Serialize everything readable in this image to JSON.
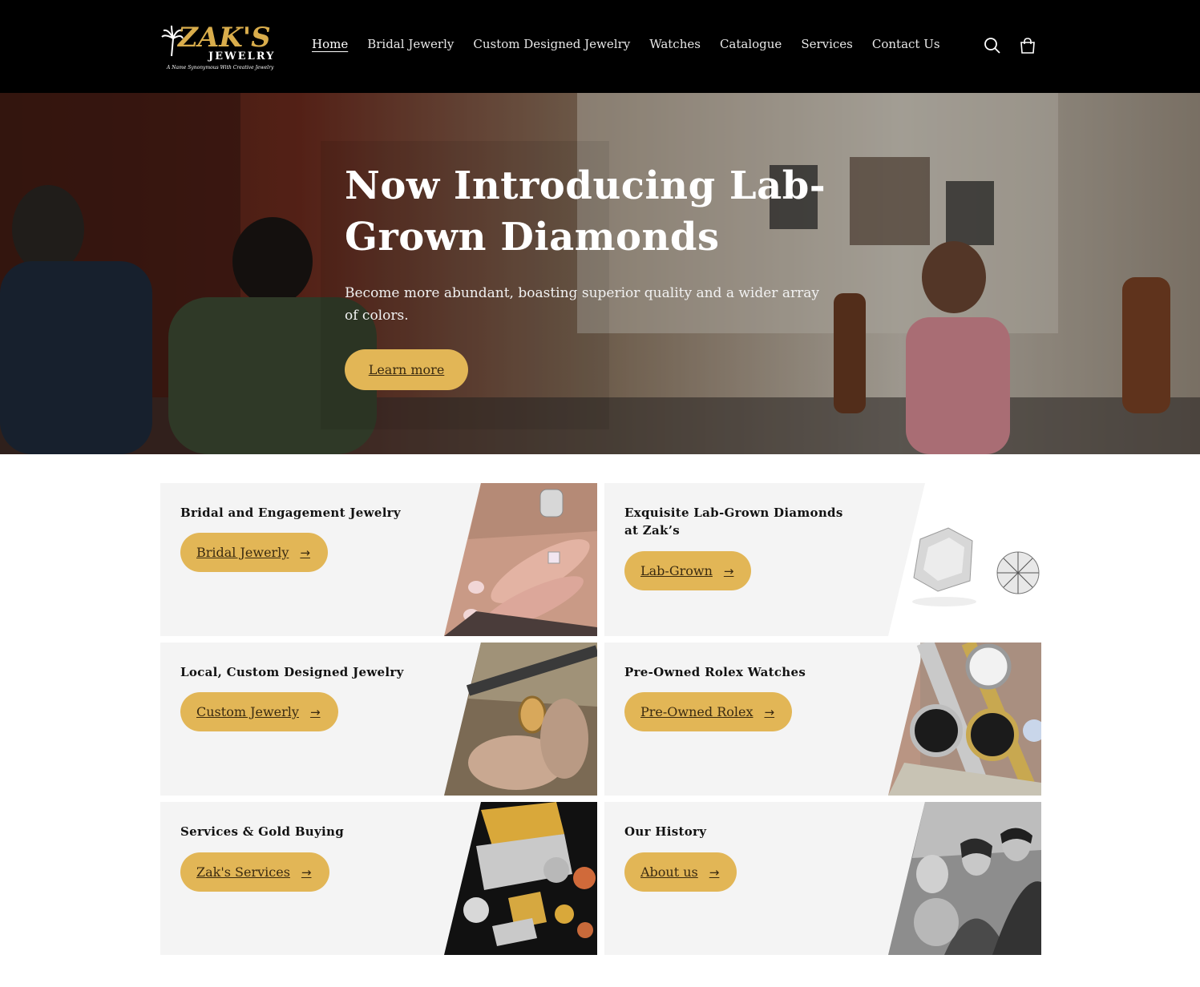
{
  "header": {
    "logo": {
      "name": "ZAK'S",
      "sub": "JEWELRY",
      "tagline": "A Name Synonymous With Creative Jewelry"
    },
    "nav": [
      {
        "label": "Home",
        "active": true
      },
      {
        "label": "Bridal Jewerly",
        "active": false
      },
      {
        "label": "Custom Designed Jewelry",
        "active": false
      },
      {
        "label": "Watches",
        "active": false
      },
      {
        "label": "Catalogue",
        "active": false
      },
      {
        "label": "Services",
        "active": false
      },
      {
        "label": "Contact Us",
        "active": false
      }
    ],
    "icons": [
      "search-icon",
      "cart-icon"
    ]
  },
  "hero": {
    "title": "Now Introducing Lab-Grown Diamonds",
    "subtitle": "Become more abundant, boasting superior quality and a wider array of colors.",
    "button": "Learn more"
  },
  "cards": [
    {
      "title": "Bridal and Engagement Jewelry",
      "button": "Bridal Jewerly",
      "image": "ring-hand-photo"
    },
    {
      "title": "Exquisite Lab-Grown Diamonds at Zak’s",
      "button": "Lab-Grown",
      "image": "lab-diamonds-photo"
    },
    {
      "title": "Local, Custom Designed Jewelry",
      "button": "Custom Jewerly",
      "image": "ring-crafting-photo"
    },
    {
      "title": "Pre-Owned Rolex Watches",
      "button": "Pre-Owned Rolex",
      "image": "rolex-watches-photo"
    },
    {
      "title": "Services & Gold Buying",
      "button": "Zak's Services",
      "image": "gold-coins-photo"
    },
    {
      "title": "Our History",
      "button": "About us",
      "image": "family-history-photo"
    }
  ],
  "colors": {
    "header_bg": "#000000",
    "accent": "#e2b656",
    "card_bg": "#f4f4f4"
  }
}
